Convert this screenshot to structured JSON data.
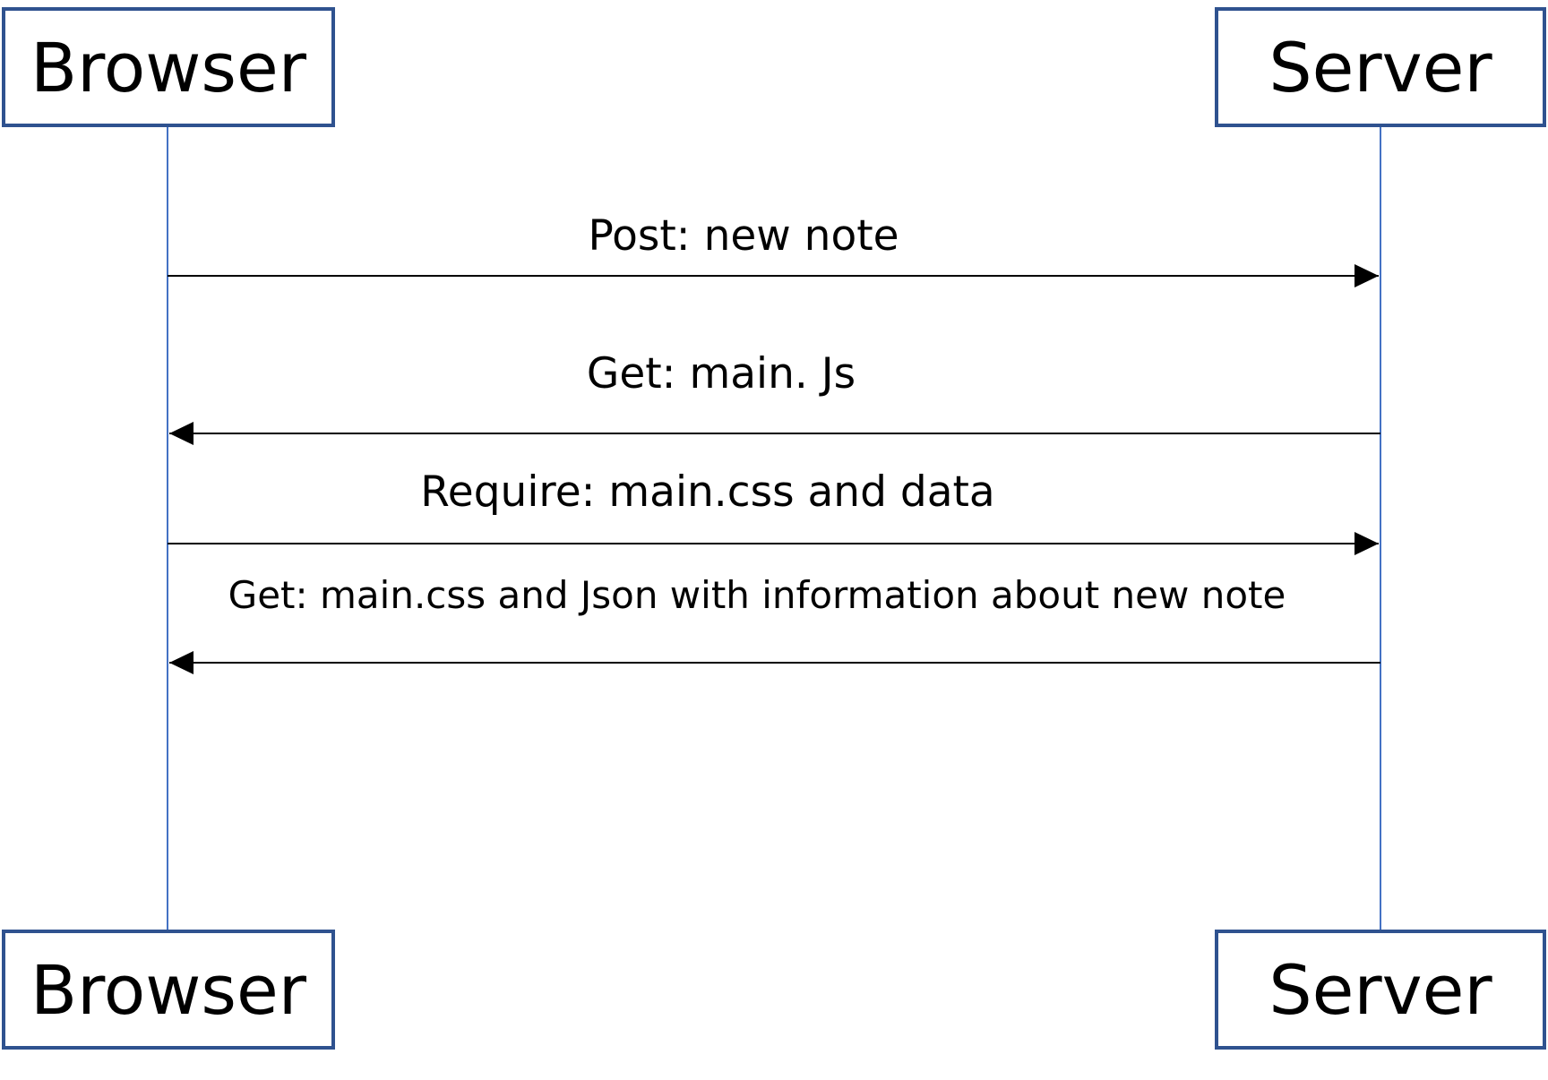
{
  "participants": {
    "left": {
      "label": "Browser"
    },
    "right": {
      "label": "Server"
    }
  },
  "messages": [
    {
      "label": "Post: new note",
      "direction": "browser-to-server"
    },
    {
      "label": "Get: main. Js",
      "direction": "server-to-browser"
    },
    {
      "label": "Require: main.css and data",
      "direction": "browser-to-server"
    },
    {
      "label": "Get: main.css and Json with information about new note",
      "direction": "server-to-browser"
    }
  ],
  "colors": {
    "box_border": "#2f528f",
    "lifeline": "#4472c4",
    "arrow": "#000000",
    "text": "#000000"
  }
}
